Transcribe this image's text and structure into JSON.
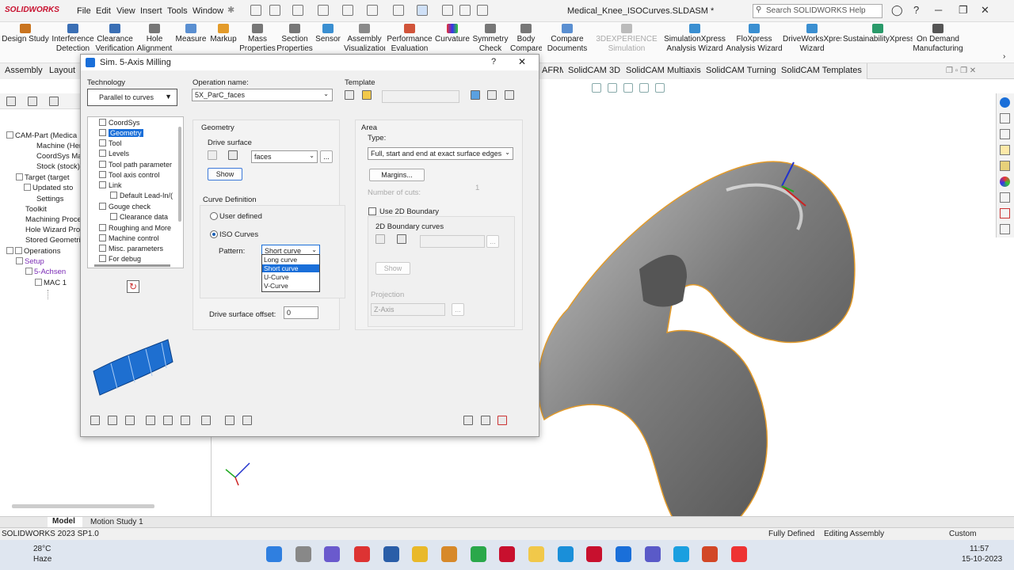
{
  "app": {
    "logo": "SOLIDWORKS",
    "doc_title": "Medical_Knee_ISOCurves.SLDASM *",
    "search_placeholder": "Search SOLIDWORKS Help"
  },
  "menu": [
    "File",
    "Edit",
    "View",
    "Insert",
    "Tools",
    "Window"
  ],
  "ribbon": [
    {
      "label": "Design Study",
      "color": "#c9741f"
    },
    {
      "label": "Interference Detection",
      "color": "#3a6fb5"
    },
    {
      "label": "Clearance Verification",
      "color": "#3a6fb5"
    },
    {
      "label": "Hole Alignment",
      "color": "#777777"
    },
    {
      "label": "Measure",
      "color": "#5a8fd1"
    },
    {
      "label": "Markup",
      "color": "#e39b2a"
    },
    {
      "label": "Mass Properties",
      "color": "#777777"
    },
    {
      "label": "Section Properties",
      "color": "#777777"
    },
    {
      "label": "Sensor",
      "color": "#3a8fd1"
    },
    {
      "label": "Assembly Visualization",
      "color": "#8a8a8a"
    },
    {
      "label": "Performance Evaluation",
      "color": "#d1543a"
    },
    {
      "label": "Curvature",
      "color": "#c23a9a"
    },
    {
      "label": "Symmetry Check",
      "color": "#777777"
    },
    {
      "label": "Body Compare",
      "color": "#777777"
    },
    {
      "label": "Compare Documents",
      "color": "#5a8fd1"
    },
    {
      "label": "3DEXPERIENCE Simulation Connector",
      "color": "#bbbbbb",
      "disabled": true
    },
    {
      "label": "SimulationXpress Analysis Wizard",
      "color": "#3a8fd1"
    },
    {
      "label": "FloXpress Analysis Wizard",
      "color": "#3a8fd1"
    },
    {
      "label": "DriveWorksXpress Wizard",
      "color": "#3a8fd1"
    },
    {
      "label": "SustainabilityXpress",
      "color": "#2a9a6a"
    },
    {
      "label": "On Demand Manufacturing",
      "color": "#555555"
    }
  ],
  "tabs": [
    "Assembly",
    "Layout",
    "AFRM",
    "SolidCAM 3D",
    "SolidCAM Multiaxis",
    "SolidCAM Turning",
    "SolidCAM Templates"
  ],
  "feature_tree": [
    "CAM-Part (Medica",
    "Machine (Herr",
    "CoordSys Mar",
    "Stock (stock)",
    "Target (target",
    "Updated sto",
    "Settings",
    "Toolkit",
    "Machining Proces",
    "Hole Wizard Proce",
    "Stored Geometrie",
    "Operations",
    "Setup",
    "5-Achsen",
    "MAC 1"
  ],
  "dialog": {
    "title": "Sim. 5-Axis Milling",
    "help": "?",
    "close": "✕",
    "technology_label": "Technology",
    "technology_value": "Parallel to curves",
    "operation_name_label": "Operation name:",
    "operation_name_value": "5X_ParC_faces",
    "template_label": "Template",
    "tree": [
      "CoordSys",
      "Geometry",
      "Tool",
      "Levels",
      "Tool path parameter",
      "Tool axis control",
      "Link",
      "Default Lead-In/(",
      "Gouge check",
      "Clearance data",
      "Roughing and More",
      "Machine control",
      "Misc. parameters",
      "For debug"
    ],
    "geometry_label": "Geometry",
    "drive_surface_label": "Drive surface",
    "drive_surface_value": "faces",
    "ellipsis": "...",
    "show_label": "Show",
    "curve_definition_label": "Curve Definition",
    "user_defined_label": "User defined",
    "iso_curves_label": "ISO Curves",
    "pattern_label": "Pattern:",
    "pattern_value": "Short curve",
    "pattern_options": [
      "Long curve",
      "Short curve",
      "U-Curve",
      "V-Curve"
    ],
    "pattern_selected_index": 1,
    "drive_offset_label": "Drive surface offset:",
    "drive_offset_value": "0",
    "area_label": "Area",
    "type_label": "Type:",
    "type_value": "Full, start and end at exact surface edges",
    "margins_label": "Margins...",
    "num_cuts_label": "Number of cuts:",
    "num_cuts_value": "1",
    "use_2d_label": "Use 2D Boundary",
    "boundary_curves_label": "2D Boundary curves",
    "show2_label": "Show",
    "projection_label": "Projection",
    "projection_value": "Z-Axis"
  },
  "bottom_tabs": [
    "Model",
    "Motion Study 1"
  ],
  "status": {
    "version": "SOLIDWORKS 2023 SP1.0",
    "defined": "Fully Defined",
    "mode": "Editing Assembly",
    "units": "Custom"
  },
  "taskbar": {
    "temp": "28°C",
    "weather": "Haze",
    "time": "11:57",
    "date": "15-10-2023"
  },
  "colors": {
    "accent": "#1a6fd9",
    "model": "#8e8e8e",
    "edge": "#e39b2a"
  }
}
